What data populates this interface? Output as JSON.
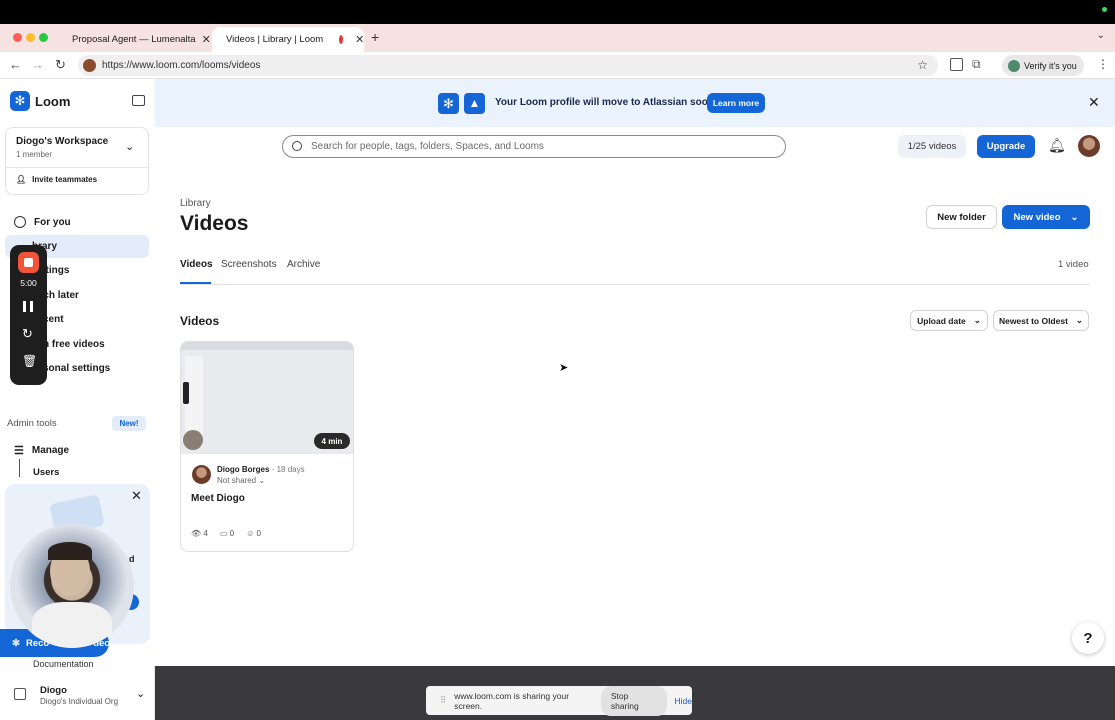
{
  "browser": {
    "tabs": [
      {
        "title": "Proposal Agent — Lumenalta"
      },
      {
        "title": "Videos | Library | Loom"
      }
    ],
    "url": "https://www.loom.com/looms/videos",
    "verify_label": "Verify it's you"
  },
  "sidebar": {
    "logo": "Loom",
    "workspace_name": "Diogo's Workspace",
    "workspace_members": "1 member",
    "invite": "Invite teammates",
    "nav": [
      {
        "label": "For you"
      },
      {
        "label": "Library"
      },
      {
        "label": "Meetings"
      },
      {
        "label": "Watch later"
      },
      {
        "label": "Recent"
      },
      {
        "label": "Earn free videos"
      },
      {
        "label": "Personal settings"
      }
    ],
    "nav_visible": [
      "For you",
      "brary",
      "etings",
      "tch later",
      "cent",
      "n free videos",
      "sonal settings"
    ],
    "admin_tools": "Admin tools",
    "admin_badge": "New!",
    "manage": "Manage",
    "users": "Users",
    "documentation": "Documentation",
    "org_name": "Diogo",
    "org_sub": "Diogo's Individual Org",
    "record_partial": "Reco",
    "record_tail": "deo",
    "promo_tail": "d"
  },
  "banner": {
    "text": "Your Loom profile will move to Atlassian soon.",
    "cta": "Learn more"
  },
  "header": {
    "search_placeholder": "Search for people, tags, folders, Spaces, and Looms",
    "quota": "1/25 videos",
    "upgrade": "Upgrade"
  },
  "library": {
    "breadcrumb": "Library",
    "title": "Videos",
    "new_folder": "New folder",
    "new_video": "New video",
    "tabs": [
      "Videos",
      "Screenshots",
      "Archive"
    ],
    "count": "1 video",
    "section_title": "Videos",
    "sort_field": "Upload date",
    "sort_order": "Newest to Oldest"
  },
  "video": {
    "duration": "4 min",
    "author": "Diogo Borges",
    "age": "18 days",
    "sharing": "Not shared",
    "title": "Meet Diogo",
    "views": "4",
    "comments": "0",
    "reactions": "0"
  },
  "recorder": {
    "time": "5:00"
  },
  "screen_share": {
    "message": "www.loom.com is sharing your screen.",
    "stop": "Stop sharing",
    "hide": "Hide"
  },
  "help_label": "?",
  "colors": {
    "accent": "#1465d6",
    "banner": "#e9f2fd",
    "record": "#f0553a"
  }
}
